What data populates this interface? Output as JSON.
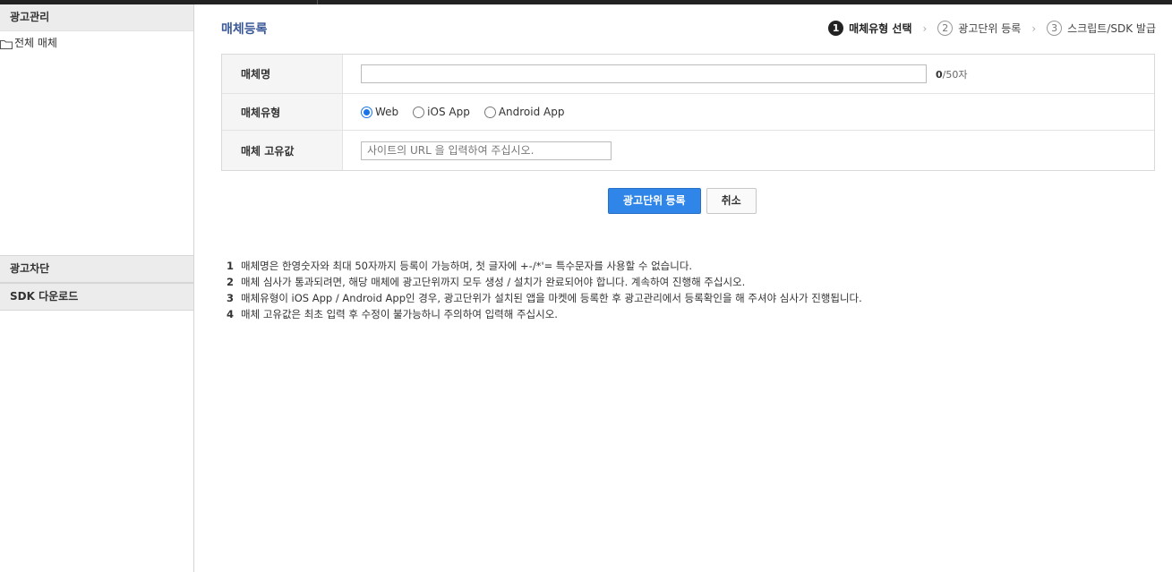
{
  "sidebar": {
    "ad_management": "광고관리",
    "tree_all_media": "전체 매체",
    "ad_blocking": "광고차단",
    "sdk_download": "SDK 다운로드"
  },
  "main": {
    "title": "매체등록",
    "steps": [
      {
        "num": "1",
        "label": "매체유형 선택",
        "active": true
      },
      {
        "num": "2",
        "label": "광고단위 등록",
        "active": false
      },
      {
        "num": "3",
        "label": "스크립트/SDK 발급",
        "active": false
      }
    ],
    "form": {
      "name_label": "매체명",
      "name_value": "",
      "name_count": "0",
      "name_max": "/50자",
      "type_label": "매체유형",
      "type_options": [
        "Web",
        "iOS App",
        "Android App"
      ],
      "type_selected": "Web",
      "key_label": "매체 고유값",
      "key_placeholder": "사이트의 URL 을 입력하여 주십시오."
    },
    "buttons": {
      "register": "광고단위 등록",
      "cancel": "취소"
    },
    "notes": [
      {
        "num": "1",
        "text": "매체명은 한영숫자와 최대 50자까지 등록이 가능하며, 첫 글자에 +-/*'= 특수문자를 사용할 수 없습니다."
      },
      {
        "num": "2",
        "text": "매체 심사가 통과되려면, 해당 매체에 광고단위까지 모두 생성 / 설치가 완료되어야 합니다. 계속하여 진행해 주십시오."
      },
      {
        "num": "3",
        "text": "매체유형이 iOS App / Android App인 경우, 광고단위가 설치된 앱을 마켓에 등록한 후 광고관리에서 등록확인을 해 주셔야 심사가 진행됩니다."
      },
      {
        "num": "4",
        "text": "매체 고유값은 최초 입력 후 수정이 불가능하니 주의하여 입력해 주십시오."
      }
    ]
  }
}
